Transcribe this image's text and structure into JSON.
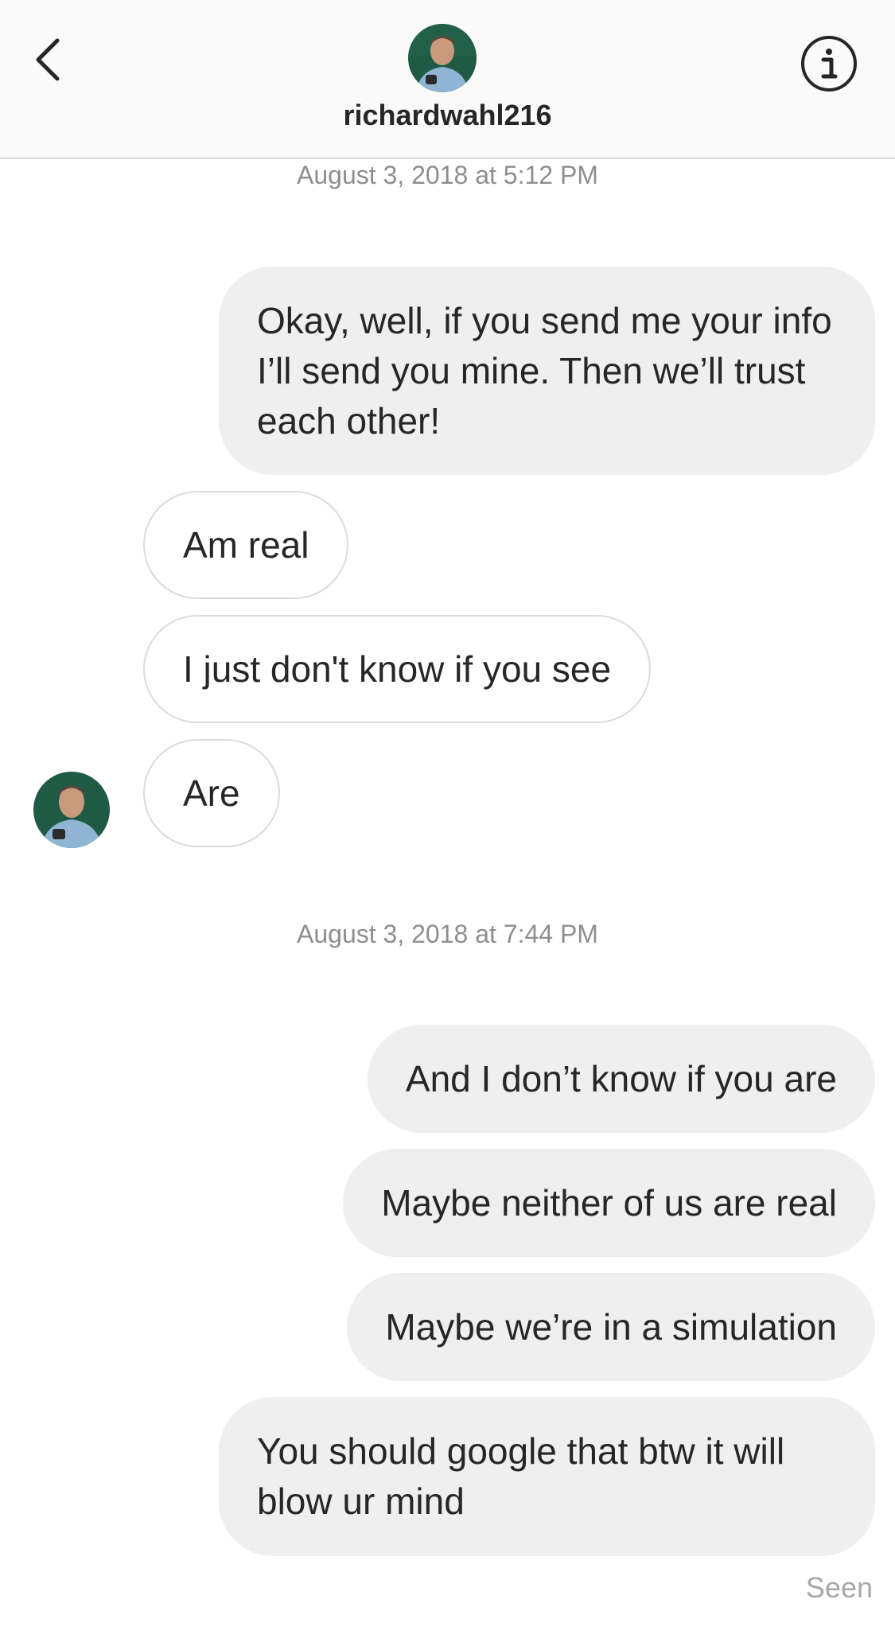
{
  "header": {
    "username": "richardwahl216",
    "back_icon": "chevron-left-icon",
    "info_icon": "info-circle-icon"
  },
  "thread": {
    "timestamp_1": "August 3, 2018 at 5:12 PM",
    "timestamp_2": "August 3, 2018 at 7:44 PM",
    "messages": [
      {
        "direction": "out",
        "text": "Okay, well, if you send me your info I’ll send you mine. Then we’ll trust each other!"
      },
      {
        "direction": "in",
        "text": "Am real"
      },
      {
        "direction": "in",
        "text": "I just don't know if you see"
      },
      {
        "direction": "in",
        "text": "Are"
      },
      {
        "direction": "out",
        "text": "And I don’t know if you are"
      },
      {
        "direction": "out",
        "text": "Maybe neither of us are real"
      },
      {
        "direction": "out",
        "text": "Maybe we’re in a simulation"
      },
      {
        "direction": "out",
        "text": "You should google that btw it will blow ur mind"
      }
    ],
    "seen_label": "Seen"
  },
  "colors": {
    "header_bg": "#fafafa",
    "outgoing_bubble": "#efefef",
    "incoming_border": "#dbdbdb",
    "text": "#262626",
    "muted": "#8e8e8e"
  }
}
